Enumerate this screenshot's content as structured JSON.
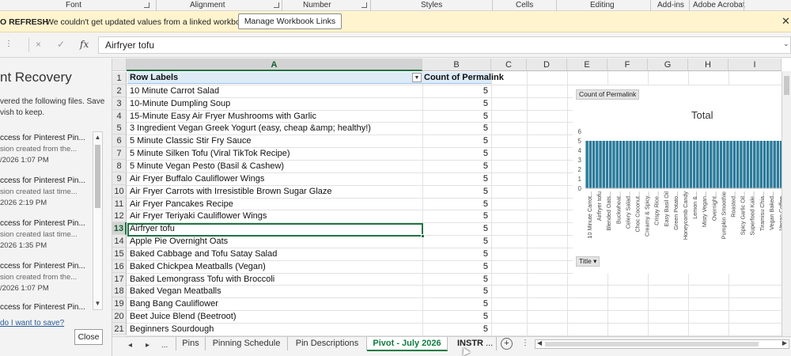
{
  "ribbon": {
    "groups": [
      "Font",
      "Alignment",
      "Number",
      "Styles",
      "Cells",
      "Editing",
      "Add-ins",
      "Adobe Acrobat"
    ]
  },
  "message_bar": {
    "title": "O REFRESH",
    "text": "We couldn't get updated values from a linked workbook.",
    "button": "Manage Workbook Links",
    "close_icon": "close-icon"
  },
  "formula_bar": {
    "cancel_icon": "×",
    "enter_icon": "✓",
    "fx_label": "fx",
    "value": "Airfryer tofu"
  },
  "recovery_pane": {
    "title": "nt Recovery",
    "description_lines": [
      "vered the following files.  Save",
      "vish to keep."
    ],
    "files": [
      {
        "name": "ccess for Pinterest Pin...",
        "note": "sion created from the...",
        "date": "/2026 1:07 PM"
      },
      {
        "name": "ccess for Pinterest Pin...",
        "note": "sion created last time...",
        "date": "2026 2:19 PM"
      },
      {
        "name": "ccess for Pinterest Pin...",
        "note": "sion created last time...",
        "date": "2026 1:35 PM"
      },
      {
        "name": "ccess for Pinterest Pin...",
        "note": "sion created from the...",
        "date": "/2026 1:07 PM"
      },
      {
        "name": "ccess for Pinterest Pin...",
        "note": "",
        "date": ""
      }
    ],
    "link": "do I want to save?",
    "close_button": "Close"
  },
  "grid": {
    "columns": [
      "A",
      "B",
      "C",
      "D",
      "E",
      "F",
      "G",
      "H",
      "I"
    ],
    "selected_column": "A",
    "selected_row": "13",
    "header": {
      "row": "1",
      "a": "Row Labels",
      "b": "Count of Permalink"
    },
    "rows": [
      {
        "n": "2",
        "a": "10 Minute Carrot Salad",
        "b": "5"
      },
      {
        "n": "3",
        "a": "10-Minute Dumpling Soup",
        "b": "5"
      },
      {
        "n": "4",
        "a": "15-Minute Easy Air Fryer Mushrooms with Garlic",
        "b": "5"
      },
      {
        "n": "5",
        "a": "3 Ingredient Vegan Greek Yogurt (easy, cheap &amp; healthy!)",
        "b": "5"
      },
      {
        "n": "6",
        "a": "5 Minute Classic Stir Fry Sauce",
        "b": "5"
      },
      {
        "n": "7",
        "a": "5 Minute Silken Tofu (Viral TikTok Recipe)",
        "b": "5"
      },
      {
        "n": "8",
        "a": "5 Minute Vegan Pesto (Basil & Cashew)",
        "b": "5"
      },
      {
        "n": "9",
        "a": "Air Fryer Buffalo Cauliflower Wings",
        "b": "5"
      },
      {
        "n": "10",
        "a": "Air Fryer Carrots with Irresistible Brown Sugar Glaze",
        "b": "5"
      },
      {
        "n": "11",
        "a": "Air Fryer Pancakes Recipe",
        "b": "5"
      },
      {
        "n": "12",
        "a": "Air Fryer Teriyaki Cauliflower Wings",
        "b": "5"
      },
      {
        "n": "13",
        "a": "Airfryer tofu",
        "b": "5"
      },
      {
        "n": "14",
        "a": "Apple Pie Overnight Oats",
        "b": "5"
      },
      {
        "n": "15",
        "a": "Baked Cabbage and Tofu Satay Salad",
        "b": "5"
      },
      {
        "n": "16",
        "a": "Baked Chickpea Meatballs (Vegan)",
        "b": "5"
      },
      {
        "n": "17",
        "a": "Baked Lemongrass Tofu with Broccoli",
        "b": "5"
      },
      {
        "n": "18",
        "a": "Baked Vegan Meatballs",
        "b": "5"
      },
      {
        "n": "19",
        "a": "Bang Bang Cauliflower",
        "b": "5"
      },
      {
        "n": "20",
        "a": "Beet Juice Blend (Beetroot)",
        "b": "5"
      },
      {
        "n": "21",
        "a": "Beginners Sourdough",
        "b": "5"
      }
    ]
  },
  "chart_data": {
    "type": "bar",
    "title": "Total",
    "field_button": "Count of Permalink",
    "axis_field_button": "Title",
    "ylim": [
      0,
      6
    ],
    "yticks": [
      "0",
      "1",
      "2",
      "3",
      "4",
      "5",
      "6"
    ],
    "bar_count": 60,
    "bar_value": 5,
    "bar_color": "#2a7a9a",
    "category_labels": [
      "10 Minute Carrot...",
      "Airfryer tofu",
      "Blended Oats...",
      "Buckwheat...",
      "Celery Salad...",
      "Choc Coconut...",
      "Creamy & Spicy...",
      "Crispy Rice...",
      "Easy Basil Oil",
      "Green Potato...",
      "Honeycomb Candy",
      "Lemon &...",
      "Misty Vegan...",
      "Overnight...",
      "Pumpkin Smoothie",
      "Roasted...",
      "Spicy Garlic Oil...",
      "Superfood Kale...",
      "Tiramisu Chia...",
      "Vegan Baked...",
      "Vegan Coffee..."
    ],
    "grid": false,
    "legend": "none"
  },
  "sheet_tabs": {
    "nav_prev": "◂",
    "nav_next": "▸",
    "more": "...",
    "tabs": [
      "Pins",
      "Pinning Schedule",
      "Pin Descriptions",
      "Pivot - July 2026",
      "INSTR"
    ],
    "active": "Pivot - July 2026",
    "add_label": "+"
  },
  "colors": {
    "accent": "#217346",
    "pivot_header": "#ddebf7",
    "message_bar": "#fff4ce"
  }
}
